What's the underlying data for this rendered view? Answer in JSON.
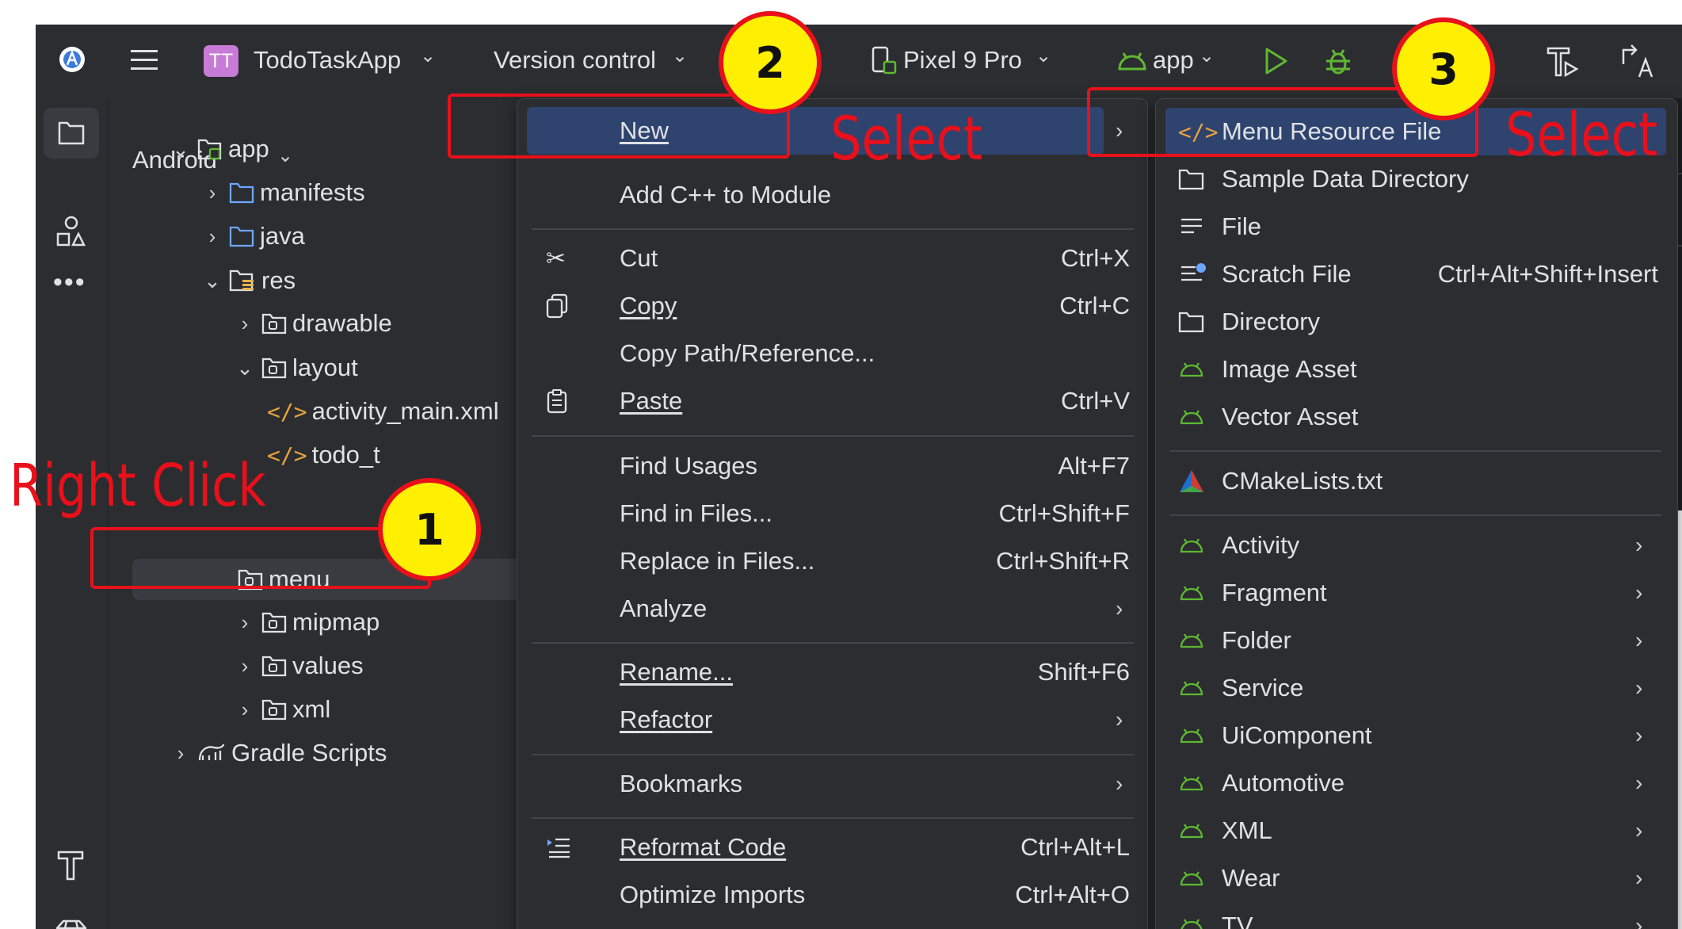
{
  "topbar": {
    "project_initials": "TT",
    "project_name": "TodoTaskApp",
    "vcs": "Version control",
    "device": "Pixel 9 Pro",
    "run_config": "app"
  },
  "project_panel": {
    "view": "Android",
    "tree": {
      "app": "app",
      "manifests": "manifests",
      "java": "java",
      "res": "res",
      "drawable": "drawable",
      "layout": "layout",
      "activity_main": "activity_main.xml",
      "todo_item": "todo_t",
      "menu": "menu",
      "mipmap": "mipmap",
      "values": "values",
      "xml": "xml",
      "gradle": "Gradle Scripts"
    }
  },
  "context_menu": {
    "new": "New",
    "add_cpp": "Add C++ to Module",
    "cut": "Cut",
    "cut_sc": "Ctrl+X",
    "copy": "Copy",
    "copy_sc": "Ctrl+C",
    "copy_path": "Copy Path/Reference...",
    "paste": "Paste",
    "paste_sc": "Ctrl+V",
    "find_usages": "Find Usages",
    "find_usages_sc": "Alt+F7",
    "find_in_files": "Find in Files...",
    "find_in_files_sc": "Ctrl+Shift+F",
    "replace_in_files": "Replace in Files...",
    "replace_in_files_sc": "Ctrl+Shift+R",
    "analyze": "Analyze",
    "rename": "Rename...",
    "rename_sc": "Shift+F6",
    "refactor": "Refactor",
    "bookmarks": "Bookmarks",
    "reformat": "Reformat Code",
    "reformat_sc": "Ctrl+Alt+L",
    "optimize": "Optimize Imports",
    "optimize_sc": "Ctrl+Alt+O"
  },
  "new_submenu": {
    "menu_resource": "Menu Resource File",
    "sample_data": "Sample Data Directory",
    "file": "File",
    "scratch": "Scratch File",
    "scratch_sc": "Ctrl+Alt+Shift+Insert",
    "directory": "Directory",
    "image_asset": "Image Asset",
    "vector_asset": "Vector Asset",
    "cmake": "CMakeLists.txt",
    "activity": "Activity",
    "fragment": "Fragment",
    "folder": "Folder",
    "service": "Service",
    "uicomponent": "UiComponent",
    "automotive": "Automotive",
    "xml": "XML",
    "wear": "Wear",
    "tv": "TV"
  },
  "annotations": {
    "right_click": "Right Click",
    "select_1": "Select",
    "select_2": "Select",
    "step1": "1",
    "step2": "2",
    "step3": "3"
  },
  "colors": {
    "ide_bg": "#2b2d30",
    "highlight": "#2e436e",
    "android_green": "#5fb832",
    "annotation_red": "#e8101a",
    "badge_yellow": "#ffef00"
  }
}
